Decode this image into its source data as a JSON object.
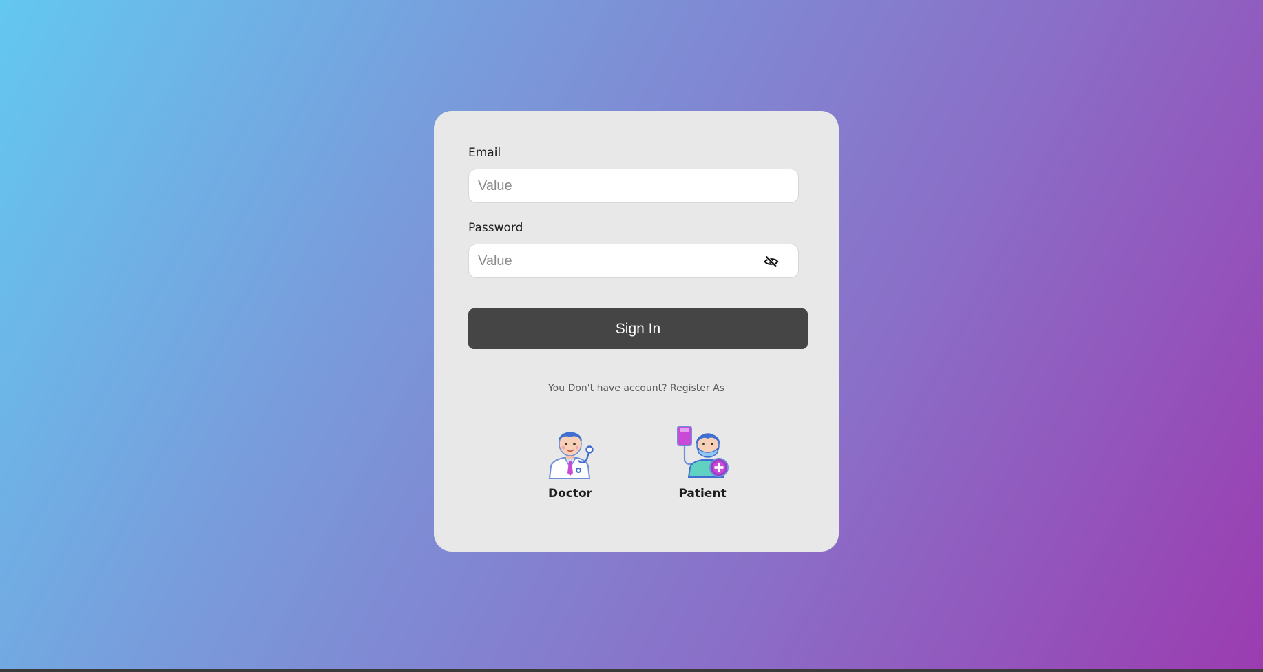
{
  "form": {
    "email_label": "Email",
    "email_placeholder": "Value",
    "password_label": "Password",
    "password_placeholder": "Value",
    "password_toggle_icon": "eye-off-icon",
    "signin_label": "Sign In"
  },
  "register": {
    "prompt": "You Don't have account? Register As",
    "roles": [
      {
        "label": "Doctor",
        "icon": "doctor-icon"
      },
      {
        "label": "Patient",
        "icon": "patient-icon"
      }
    ]
  },
  "colors": {
    "gradient_start": "#63c8f0",
    "gradient_end": "#9b3cb0",
    "card_bg": "#e8e8e8",
    "button_bg": "#454545"
  }
}
